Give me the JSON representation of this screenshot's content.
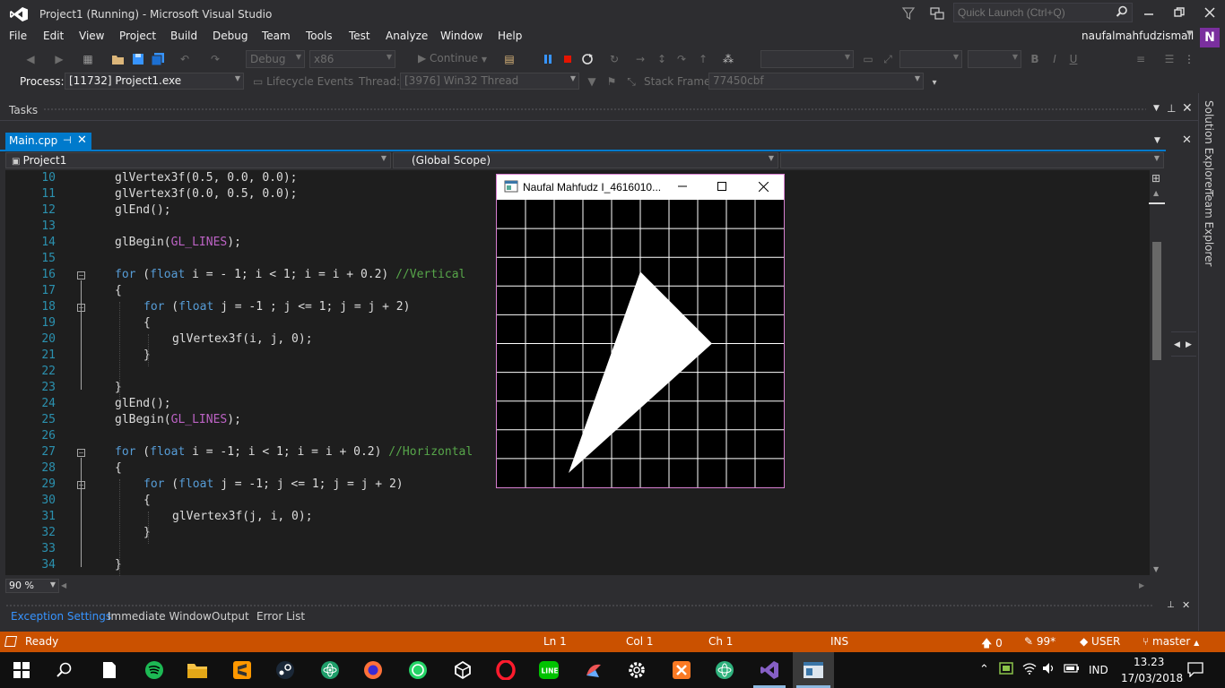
{
  "window": {
    "title": "Project1 (Running) - Microsoft Visual Studio",
    "quick_launch_placeholder": "Quick Launch (Ctrl+Q)",
    "user": "naufalmahfudzismail",
    "onenote_letter": "N"
  },
  "menu": [
    "File",
    "Edit",
    "View",
    "Project",
    "Build",
    "Debug",
    "Team",
    "Tools",
    "Test",
    "Analyze",
    "Window",
    "Help"
  ],
  "toolbar": {
    "config": "Debug",
    "platform": "x86",
    "continue_label": "Continue"
  },
  "debug_bar": {
    "process_label": "Process:",
    "process_value": "[11732] Project1.exe",
    "lifecycle_label": "Lifecycle Events",
    "thread_label": "Thread:",
    "thread_value": "[3976] Win32 Thread",
    "stack_label": "Stack Frame:",
    "stack_value": "77450cbf"
  },
  "tasks_panel": {
    "title": "Tasks"
  },
  "side_tabs": [
    "Solution Explorer",
    "Team Explorer"
  ],
  "document_tab": {
    "name": "Main.cpp"
  },
  "nav": {
    "project": "Project1",
    "scope": "(Global Scope)"
  },
  "code_lines": [
    {
      "n": "10",
      "indent": 1,
      "parts": [
        [
          "t",
          "glVertex3f(0.5, 0.0, 0.0);"
        ]
      ]
    },
    {
      "n": "11",
      "indent": 1,
      "parts": [
        [
          "t",
          "glVertex3f(0.0, 0.5, 0.0);"
        ]
      ]
    },
    {
      "n": "12",
      "indent": 1,
      "parts": [
        [
          "t",
          "glEnd();"
        ]
      ]
    },
    {
      "n": "13",
      "indent": 1,
      "parts": []
    },
    {
      "n": "14",
      "indent": 1,
      "parts": [
        [
          "t",
          "glBegin("
        ],
        [
          "m",
          "GL_LINES"
        ],
        [
          "t",
          ");"
        ]
      ]
    },
    {
      "n": "15",
      "indent": 1,
      "parts": []
    },
    {
      "n": "16",
      "indent": 1,
      "parts": [
        [
          "k",
          "for"
        ],
        [
          "t",
          " ("
        ],
        [
          "k",
          "float"
        ],
        [
          "t",
          " i = - 1; i < 1; i = i + 0.2) "
        ],
        [
          "c",
          "//Vertical"
        ]
      ]
    },
    {
      "n": "17",
      "indent": 1,
      "parts": [
        [
          "t",
          "{"
        ]
      ]
    },
    {
      "n": "18",
      "indent": 2,
      "parts": [
        [
          "k",
          "for"
        ],
        [
          "t",
          " ("
        ],
        [
          "k",
          "float"
        ],
        [
          "t",
          " j = -1 ; j <= 1; j = j + 2)"
        ]
      ]
    },
    {
      "n": "19",
      "indent": 2,
      "parts": [
        [
          "t",
          "{"
        ]
      ]
    },
    {
      "n": "20",
      "indent": 3,
      "parts": [
        [
          "t",
          "glVertex3f(i, j, 0);"
        ]
      ]
    },
    {
      "n": "21",
      "indent": 2,
      "parts": [
        [
          "t",
          "}"
        ]
      ]
    },
    {
      "n": "22",
      "indent": 1,
      "parts": []
    },
    {
      "n": "23",
      "indent": 1,
      "parts": [
        [
          "t",
          "}"
        ]
      ]
    },
    {
      "n": "24",
      "indent": 1,
      "parts": [
        [
          "t",
          "glEnd();"
        ]
      ]
    },
    {
      "n": "25",
      "indent": 1,
      "parts": [
        [
          "t",
          "glBegin("
        ],
        [
          "m",
          "GL_LINES"
        ],
        [
          "t",
          ");"
        ]
      ]
    },
    {
      "n": "26",
      "indent": 1,
      "parts": []
    },
    {
      "n": "27",
      "indent": 1,
      "parts": [
        [
          "k",
          "for"
        ],
        [
          "t",
          " ("
        ],
        [
          "k",
          "float"
        ],
        [
          "t",
          " i = -1; i < 1; i = i + 0.2) "
        ],
        [
          "c",
          "//Horizontal"
        ]
      ]
    },
    {
      "n": "28",
      "indent": 1,
      "parts": [
        [
          "t",
          "{"
        ]
      ]
    },
    {
      "n": "29",
      "indent": 2,
      "parts": [
        [
          "k",
          "for"
        ],
        [
          "t",
          " ("
        ],
        [
          "k",
          "float"
        ],
        [
          "t",
          " j = -1; j <= 1; j = j + 2)"
        ]
      ]
    },
    {
      "n": "30",
      "indent": 2,
      "parts": [
        [
          "t",
          "{"
        ]
      ]
    },
    {
      "n": "31",
      "indent": 3,
      "parts": [
        [
          "t",
          "glVertex3f(j, i, 0);"
        ]
      ]
    },
    {
      "n": "32",
      "indent": 2,
      "parts": [
        [
          "t",
          "}"
        ]
      ]
    },
    {
      "n": "33",
      "indent": 1,
      "parts": []
    },
    {
      "n": "34",
      "indent": 1,
      "parts": [
        [
          "t",
          "}"
        ]
      ]
    }
  ],
  "editor": {
    "zoom": "90 %"
  },
  "output_tabs": [
    "Exception Settings",
    "Immediate Window",
    "Output",
    "Error List"
  ],
  "status": {
    "state": "Ready",
    "ln": "Ln 1",
    "col": "Col 1",
    "ch": "Ch 1",
    "mode": "INS",
    "up_count": "0",
    "pencil_count": "99*",
    "user": "USER",
    "branch": "master"
  },
  "gl_window": {
    "title": "Naufal Mahfudz I_4616010...",
    "grid_divisions": 10,
    "triangle": [
      [
        0.5,
        0.0
      ],
      [
        0.0,
        0.5
      ],
      [
        -0.5,
        -0.9
      ]
    ]
  },
  "taskbar": {
    "lang": "IND",
    "time": "13.23",
    "date": "17/03/2018"
  },
  "colors": {
    "accent": "#007acc",
    "status_bar": "#ca5100",
    "keyword": "#569cd6",
    "macro": "#bd63c5",
    "comment": "#57a64a",
    "line_number": "#2b91af"
  }
}
